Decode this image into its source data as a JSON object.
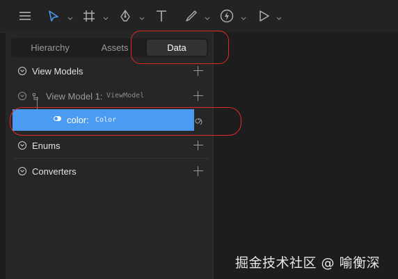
{
  "toolbar": {
    "tools": [
      {
        "icon": "menu-icon"
      },
      {
        "icon": "select-arrow-icon",
        "accent": "#4b9bf3"
      },
      {
        "icon": "frame-icon"
      },
      {
        "icon": "pen-icon"
      },
      {
        "icon": "text-icon"
      },
      {
        "icon": "paint-icon"
      },
      {
        "icon": "bolt-icon"
      },
      {
        "icon": "play-icon"
      }
    ]
  },
  "tabs": [
    {
      "label": "Hierarchy",
      "active": false
    },
    {
      "label": "Assets",
      "active": false
    },
    {
      "label": "Data",
      "active": true
    }
  ],
  "sections": {
    "view_models": {
      "label": "View Models"
    },
    "view_model_1": {
      "name": "View Model 1:",
      "type": "ViewModel"
    },
    "color_property": {
      "name": "color:",
      "type": "Color"
    },
    "enums": {
      "label": "Enums"
    },
    "converters": {
      "label": "Converters"
    }
  },
  "watermark": "掘金技术社区 @ 喻衡深",
  "colors": {
    "accent": "#4b9bf3",
    "annotation": "#e02a2a"
  }
}
